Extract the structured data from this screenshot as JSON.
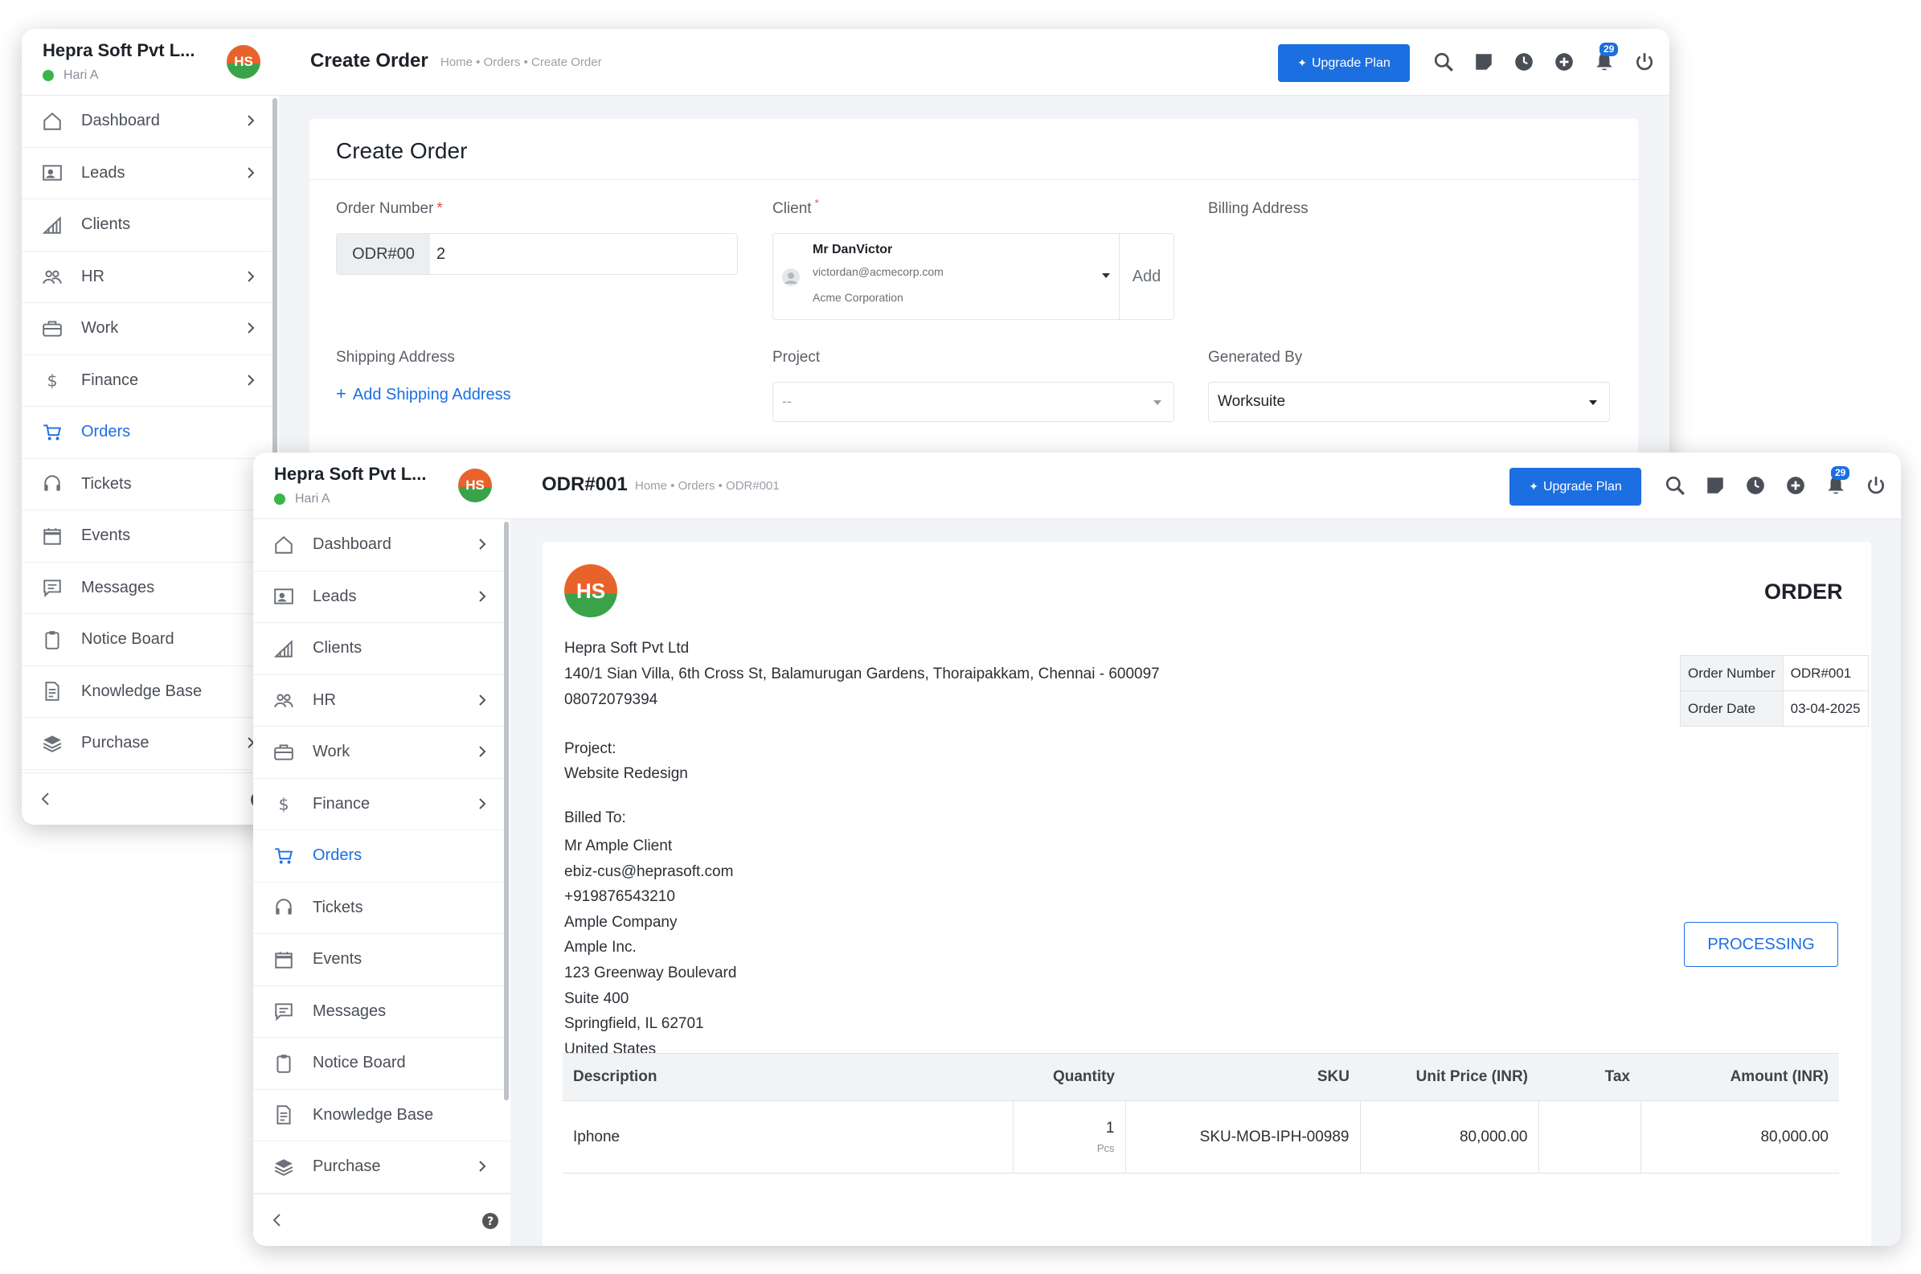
{
  "company": "Hepra Soft Pvt L...",
  "user": "Hari A",
  "logo_text": "HS",
  "nav": [
    {
      "label": "Dashboard",
      "icon": "home-icon",
      "chevron": true
    },
    {
      "label": "Leads",
      "icon": "contact-card-icon",
      "chevron": true
    },
    {
      "label": "Clients",
      "icon": "chart-bars-icon",
      "chevron": false
    },
    {
      "label": "HR",
      "icon": "users-icon",
      "chevron": true
    },
    {
      "label": "Work",
      "icon": "briefcase-icon",
      "chevron": true
    },
    {
      "label": "Finance",
      "icon": "dollar-icon",
      "chevron": true
    },
    {
      "label": "Orders",
      "icon": "cart-icon",
      "chevron": false,
      "active": true
    },
    {
      "label": "Tickets",
      "icon": "headset-icon",
      "chevron": false
    },
    {
      "label": "Events",
      "icon": "calendar-icon",
      "chevron": false
    },
    {
      "label": "Messages",
      "icon": "message-icon",
      "chevron": false
    },
    {
      "label": "Notice Board",
      "icon": "clipboard-icon",
      "chevron": false
    },
    {
      "label": "Knowledge Base",
      "icon": "document-icon",
      "chevron": false
    },
    {
      "label": "Purchase",
      "icon": "layers-icon",
      "chevron": true
    }
  ],
  "topbar": {
    "upgrade": "Upgrade Plan",
    "notif_count": "29"
  },
  "create_order": {
    "title": "Create Order",
    "breadcrumb": "Home • Orders • Create Order",
    "card_title": "Create Order",
    "order_number_label": "Order Number",
    "order_prefix": "ODR#00",
    "order_value": "2",
    "client_label": "Client",
    "client_name": "Mr DanVictor",
    "client_email": "victordan@acmecorp.com",
    "client_company": "Acme Corporation",
    "add_label": "Add",
    "billing_label": "Billing Address",
    "shipping_label": "Shipping Address",
    "add_shipping": "Add Shipping Address",
    "project_label": "Project",
    "project_value": "--",
    "generated_label": "Generated By",
    "generated_value": "Worksuite"
  },
  "order_view": {
    "title": "ODR#001",
    "breadcrumb": "Home • Orders • ODR#001",
    "heading": "ORDER",
    "company_name": "Hepra Soft Pvt Ltd",
    "company_address": "140/1 Sian Villa, 6th Cross St, Balamurugan Gardens, Thoraipakkam, Chennai - 600097",
    "company_phone": "08072079394",
    "project_label": "Project:",
    "project_name": "Website Redesign",
    "billed_to": "Billed To:",
    "billed_lines": [
      "Mr Ample Client",
      "ebiz-cus@heprasoft.com",
      "+919876543210",
      "Ample Company",
      "Ample Inc.",
      "123 Greenway Boulevard",
      "Suite 400",
      "Springfield, IL 62701",
      "United States"
    ],
    "order_number_label": "Order Number",
    "order_number": "ODR#001",
    "order_date_label": "Order Date",
    "order_date": "03-04-2025",
    "status": "PROCESSING",
    "columns": [
      "Description",
      "Quantity",
      "SKU",
      "Unit Price (INR)",
      "Tax",
      "Amount (INR)"
    ],
    "row": {
      "description": "Iphone",
      "quantity": "1",
      "unit": "Pcs",
      "sku": "SKU-MOB-IPH-00989",
      "unit_price": "80,000.00",
      "tax": "",
      "amount": "80,000.00"
    }
  },
  "colors": {
    "accent": "#1c6fe0",
    "online": "#3ab54a",
    "required": "#e34b4b"
  }
}
